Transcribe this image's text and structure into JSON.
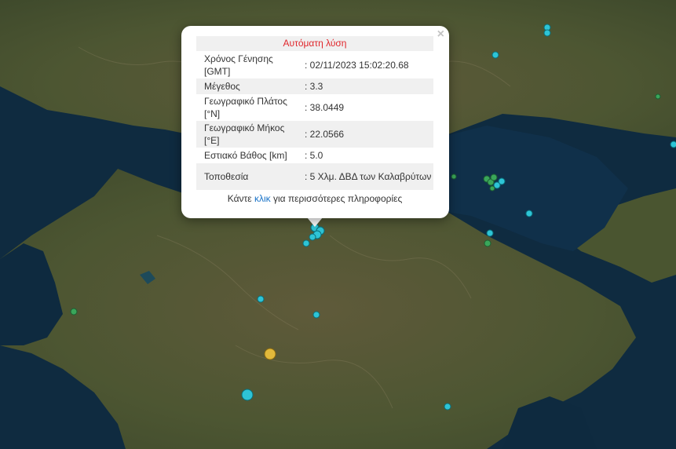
{
  "popup": {
    "title": "Αυτόματη λύση",
    "close_glyph": "×",
    "rows": [
      {
        "label": "Χρόνος Γένησης [GMT]",
        "value": ": 02/11/2023 15:02:20.68"
      },
      {
        "label": "Μέγεθος",
        "value": ": 3.3"
      },
      {
        "label": "Γεωγραφικό Πλάτος [°N]",
        "value": ": 38.0449"
      },
      {
        "label": "Γεωγραφικό Μήκος [°E]",
        "value": ": 22.0566"
      },
      {
        "label": "Εστιακό Βάθος [km]",
        "value": ": 5.0"
      },
      {
        "label": "Τοποθεσία",
        "value": ": 5 Χλμ. ΔΒΔ των Καλαβρύτων"
      }
    ],
    "more_prefix": "Κάντε ",
    "more_link": "κλικ",
    "more_suffix": " για περισσότερες πληροφορίες"
  },
  "colors": {
    "sea": "#0e2a3f",
    "land": "#4b5632",
    "marker_cyan": "#2ec4d6",
    "marker_green": "#3aa65a",
    "marker_yellow": "#e2b93b",
    "title_red": "#e0262b"
  }
}
